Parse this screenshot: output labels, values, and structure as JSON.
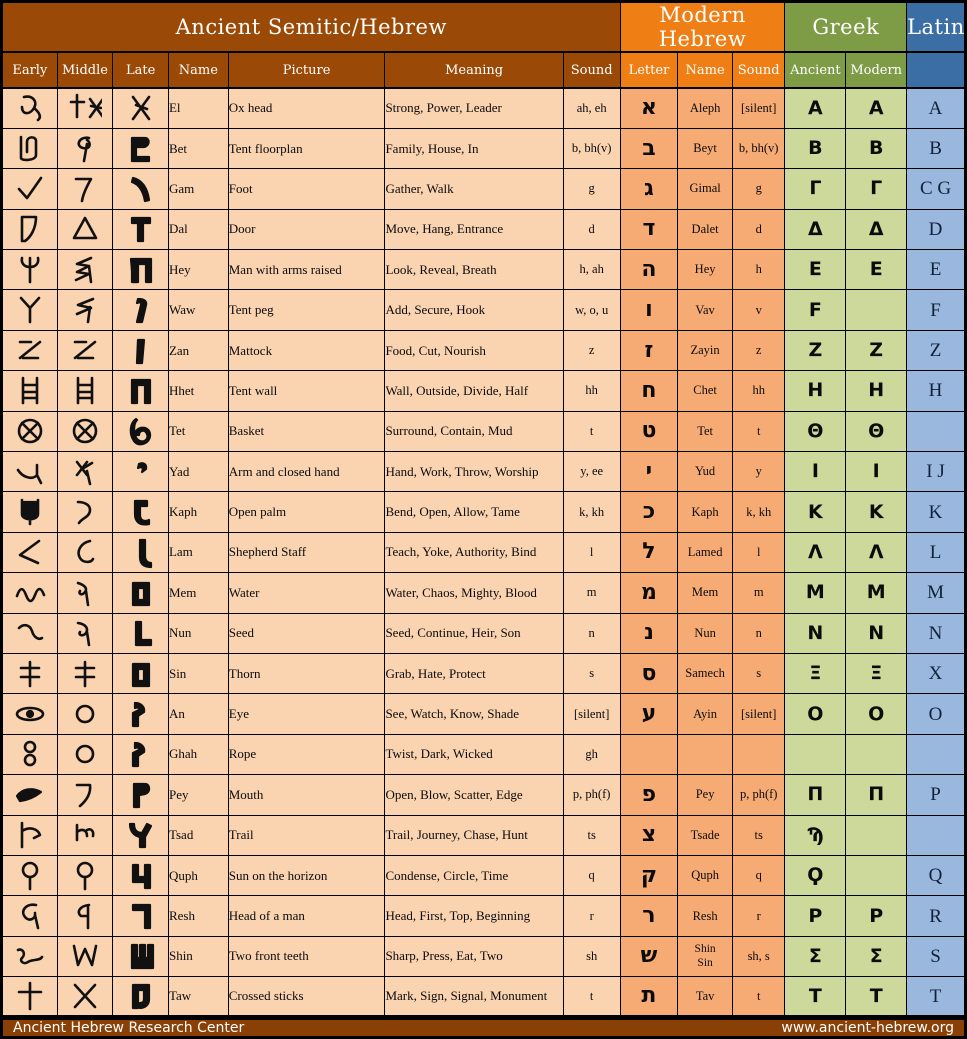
{
  "colors": {
    "semitic_header": "#9a4a06",
    "modern_header": "#ef7e15",
    "greek_header": "#7d9c45",
    "latin_header": "#3a6ea5",
    "semitic_cell": "#fad3b1",
    "modern_cell": "#f7ab74",
    "greek_cell": "#ccd99a",
    "latin_cell": "#9ab8dd",
    "footer": "#8a3f05",
    "border": "#000000"
  },
  "groups": [
    {
      "label": "Ancient Semitic/Hebrew",
      "span": 7
    },
    {
      "label": "Modern Hebrew",
      "span": 3
    },
    {
      "label": "Greek",
      "span": 2
    },
    {
      "label": "Latin",
      "span": 1
    }
  ],
  "columns": [
    {
      "label": "Early",
      "group": "semitic"
    },
    {
      "label": "Middle",
      "group": "semitic"
    },
    {
      "label": "Late",
      "group": "semitic"
    },
    {
      "label": "Name",
      "group": "semitic"
    },
    {
      "label": "Picture",
      "group": "semitic"
    },
    {
      "label": "Meaning",
      "group": "semitic"
    },
    {
      "label": "Sound",
      "group": "semitic"
    },
    {
      "label": "Letter",
      "group": "modern"
    },
    {
      "label": "Name",
      "group": "modern"
    },
    {
      "label": "Sound",
      "group": "modern"
    },
    {
      "label": "Ancient",
      "group": "greek"
    },
    {
      "label": "Modern",
      "group": "greek"
    },
    {
      "label": "",
      "group": "latin"
    }
  ],
  "rows": [
    {
      "name": "El",
      "picture": "Ox head",
      "meaning": "Strong, Power, Leader",
      "sound": "ah, eh",
      "heb_letter": "א",
      "heb_name": "Aleph",
      "heb_sound": "[silent]",
      "greek_ancient": "Α",
      "greek_modern": "Α",
      "latin": "A",
      "early": "ox-head-early",
      "middle": "ox-head-middle",
      "late": "ox-head-late"
    },
    {
      "name": "Bet",
      "picture": "Tent floorplan",
      "meaning": "Family, House, In",
      "sound": "b, bh(v)",
      "heb_letter": "ב",
      "heb_name": "Beyt",
      "heb_sound": "b, bh(v)",
      "greek_ancient": "Β",
      "greek_modern": "Β",
      "latin": "B",
      "early": "tent-floorplan-early",
      "middle": "tent-floorplan-middle",
      "late": "tent-floorplan-late"
    },
    {
      "name": "Gam",
      "picture": "Foot",
      "meaning": "Gather, Walk",
      "sound": "g",
      "heb_letter": "ג",
      "heb_name": "Gimal",
      "heb_sound": "g",
      "greek_ancient": "Γ",
      "greek_modern": "Γ",
      "latin": "C G",
      "early": "foot-early",
      "middle": "foot-middle",
      "late": "foot-late"
    },
    {
      "name": "Dal",
      "picture": "Door",
      "meaning": "Move, Hang, Entrance",
      "sound": "d",
      "heb_letter": "ד",
      "heb_name": "Dalet",
      "heb_sound": "d",
      "greek_ancient": "Δ",
      "greek_modern": "Δ",
      "latin": "D",
      "early": "door-early",
      "middle": "door-middle",
      "late": "door-late"
    },
    {
      "name": "Hey",
      "picture": "Man with arms raised",
      "meaning": "Look, Reveal, Breath",
      "sound": "h, ah",
      "heb_letter": "ה",
      "heb_name": "Hey",
      "heb_sound": "h",
      "greek_ancient": "Ε",
      "greek_modern": "Ε",
      "latin": "E",
      "early": "man-arms-early",
      "middle": "man-arms-middle",
      "late": "man-arms-late"
    },
    {
      "name": "Waw",
      "picture": "Tent peg",
      "meaning": "Add, Secure, Hook",
      "sound": "w, o, u",
      "heb_letter": "ו",
      "heb_name": "Vav",
      "heb_sound": "v",
      "greek_ancient": "Ϝ",
      "greek_modern": "",
      "latin": "F",
      "early": "tent-peg-early",
      "middle": "tent-peg-middle",
      "late": "tent-peg-late"
    },
    {
      "name": "Zan",
      "picture": "Mattock",
      "meaning": "Food, Cut, Nourish",
      "sound": "z",
      "heb_letter": "ז",
      "heb_name": "Zayin",
      "heb_sound": "z",
      "greek_ancient": "Ζ",
      "greek_modern": "Ζ",
      "latin": "Z",
      "early": "mattock-early",
      "middle": "mattock-middle",
      "late": "mattock-late"
    },
    {
      "name": "Hhet",
      "picture": "Tent wall",
      "meaning": "Wall, Outside, Divide, Half",
      "sound": "hh",
      "heb_letter": "ח",
      "heb_name": "Chet",
      "heb_sound": "hh",
      "greek_ancient": "Η",
      "greek_modern": "Η",
      "latin": "H",
      "early": "tent-wall-early",
      "middle": "tent-wall-middle",
      "late": "tent-wall-late"
    },
    {
      "name": "Tet",
      "picture": "Basket",
      "meaning": "Surround, Contain, Mud",
      "sound": "t",
      "heb_letter": "ט",
      "heb_name": "Tet",
      "heb_sound": "t",
      "greek_ancient": "Θ",
      "greek_modern": "Θ",
      "latin": "",
      "early": "basket-early",
      "middle": "basket-middle",
      "late": "basket-late"
    },
    {
      "name": "Yad",
      "picture": "Arm and closed hand",
      "meaning": "Hand, Work, Throw, Worship",
      "sound": "y, ee",
      "heb_letter": "י",
      "heb_name": "Yud",
      "heb_sound": "y",
      "greek_ancient": "Ι",
      "greek_modern": "Ι",
      "latin": "I J",
      "early": "arm-hand-early",
      "middle": "arm-hand-middle",
      "late": "arm-hand-late"
    },
    {
      "name": "Kaph",
      "picture": "Open palm",
      "meaning": "Bend, Open, Allow, Tame",
      "sound": "k, kh",
      "heb_letter": "כ",
      "heb_name": "Kaph",
      "heb_sound": "k, kh",
      "greek_ancient": "Κ",
      "greek_modern": "Κ",
      "latin": "K",
      "early": "open-palm-early",
      "middle": "open-palm-middle",
      "late": "open-palm-late"
    },
    {
      "name": "Lam",
      "picture": "Shepherd Staff",
      "meaning": "Teach, Yoke, Authority, Bind",
      "sound": "l",
      "heb_letter": "ל",
      "heb_name": "Lamed",
      "heb_sound": "l",
      "greek_ancient": "Λ",
      "greek_modern": "Λ",
      "latin": "L",
      "early": "staff-early",
      "middle": "staff-middle",
      "late": "staff-late"
    },
    {
      "name": "Mem",
      "picture": "Water",
      "meaning": "Water, Chaos, Mighty, Blood",
      "sound": "m",
      "heb_letter": "מ",
      "heb_name": "Mem",
      "heb_sound": "m",
      "greek_ancient": "Μ",
      "greek_modern": "Μ",
      "latin": "M",
      "early": "water-early",
      "middle": "water-middle",
      "late": "water-late"
    },
    {
      "name": "Nun",
      "picture": "Seed",
      "meaning": "Seed, Continue, Heir, Son",
      "sound": "n",
      "heb_letter": "נ",
      "heb_name": "Nun",
      "heb_sound": "n",
      "greek_ancient": "Ν",
      "greek_modern": "Ν",
      "latin": "N",
      "early": "seed-early",
      "middle": "seed-middle",
      "late": "seed-late"
    },
    {
      "name": "Sin",
      "picture": "Thorn",
      "meaning": "Grab, Hate, Protect",
      "sound": "s",
      "heb_letter": "ס",
      "heb_name": "Samech",
      "heb_sound": "s",
      "greek_ancient": "Ξ",
      "greek_modern": "Ξ",
      "latin": "X",
      "early": "thorn-early",
      "middle": "thorn-middle",
      "late": "thorn-late"
    },
    {
      "name": "An",
      "picture": "Eye",
      "meaning": "See, Watch, Know, Shade",
      "sound": "[silent]",
      "heb_letter": "ע",
      "heb_name": "Ayin",
      "heb_sound": "[silent]",
      "greek_ancient": "Ο",
      "greek_modern": "Ο",
      "latin": "O",
      "early": "eye-early",
      "middle": "eye-middle",
      "late": "eye-late"
    },
    {
      "name": "Ghah",
      "picture": "Rope",
      "meaning": "Twist, Dark, Wicked",
      "sound": "gh",
      "heb_letter": "",
      "heb_name": "",
      "heb_sound": "",
      "greek_ancient": "",
      "greek_modern": "",
      "latin": "",
      "early": "rope-early",
      "middle": "rope-middle",
      "late": "rope-late"
    },
    {
      "name": "Pey",
      "picture": "Mouth",
      "meaning": "Open, Blow, Scatter, Edge",
      "sound": "p, ph(f)",
      "heb_letter": "פ",
      "heb_name": "Pey",
      "heb_sound": "p, ph(f)",
      "greek_ancient": "Π",
      "greek_modern": "Π",
      "latin": "P",
      "early": "mouth-early",
      "middle": "mouth-middle",
      "late": "mouth-late"
    },
    {
      "name": "Tsad",
      "picture": "Trail",
      "meaning": "Trail, Journey, Chase, Hunt",
      "sound": "ts",
      "heb_letter": "צ",
      "heb_name": "Tsade",
      "heb_sound": "ts",
      "greek_ancient": "Ϡ",
      "greek_modern": "",
      "latin": "",
      "early": "trail-early",
      "middle": "trail-middle",
      "late": "trail-late"
    },
    {
      "name": "Quph",
      "picture": "Sun on the horizon",
      "meaning": "Condense, Circle, Time",
      "sound": "q",
      "heb_letter": "ק",
      "heb_name": "Quph",
      "heb_sound": "q",
      "greek_ancient": "Ϙ",
      "greek_modern": "",
      "latin": "Q",
      "early": "sun-horizon-early",
      "middle": "sun-horizon-middle",
      "late": "sun-horizon-late"
    },
    {
      "name": "Resh",
      "picture": "Head of a man",
      "meaning": "Head, First, Top, Beginning",
      "sound": "r",
      "heb_letter": "ר",
      "heb_name": "Resh",
      "heb_sound": "r",
      "greek_ancient": "Ρ",
      "greek_modern": "Ρ",
      "latin": "R",
      "early": "head-man-early",
      "middle": "head-man-middle",
      "late": "head-man-late"
    },
    {
      "name": "Shin",
      "picture": "Two front teeth",
      "meaning": "Sharp, Press, Eat, Two",
      "sound": "sh",
      "heb_letter": "ש",
      "heb_name": "Shin\nSin",
      "heb_sound": "sh, s",
      "greek_ancient": "Σ",
      "greek_modern": "Σ",
      "latin": "S",
      "early": "teeth-early",
      "middle": "teeth-middle",
      "late": "teeth-late"
    },
    {
      "name": "Taw",
      "picture": "Crossed sticks",
      "meaning": "Mark, Sign, Signal, Monument",
      "sound": "t",
      "heb_letter": "ת",
      "heb_name": "Tav",
      "heb_sound": "t",
      "greek_ancient": "Τ",
      "greek_modern": "Τ",
      "latin": "T",
      "early": "crossed-sticks-early",
      "middle": "crossed-sticks-middle",
      "late": "crossed-sticks-late"
    }
  ],
  "footer": {
    "left": "Ancient Hebrew Research Center",
    "right": "www.ancient-hebrew.org"
  }
}
